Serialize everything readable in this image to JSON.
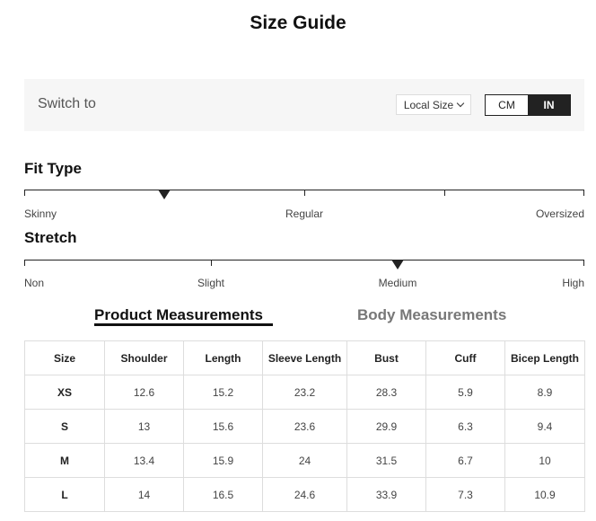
{
  "title": "Size Guide",
  "switch": {
    "label": "Switch to",
    "size_select": "Local Size",
    "units": [
      "CM",
      "IN"
    ],
    "active_unit": "IN"
  },
  "fit_type": {
    "title": "Fit Type",
    "labels": [
      "Skinny",
      "Regular",
      "Oversized"
    ],
    "level": 0.25
  },
  "stretch": {
    "title": "Stretch",
    "labels": [
      "Non",
      "Slight",
      "Medium",
      "High"
    ],
    "level": 0.667
  },
  "tabs": [
    {
      "label": "Product Measurements",
      "active": true
    },
    {
      "label": "Body Measurements",
      "active": false
    }
  ],
  "table": {
    "headers": [
      "Size",
      "Shoulder",
      "Length",
      "Sleeve Length",
      "Bust",
      "Cuff",
      "Bicep Length"
    ],
    "rows": [
      [
        "XS",
        "12.6",
        "15.2",
        "23.2",
        "28.3",
        "5.9",
        "8.9"
      ],
      [
        "S",
        "13",
        "15.6",
        "23.6",
        "29.9",
        "6.3",
        "9.4"
      ],
      [
        "M",
        "13.4",
        "15.9",
        "24",
        "31.5",
        "6.7",
        "10"
      ],
      [
        "L",
        "14",
        "16.5",
        "24.6",
        "33.9",
        "7.3",
        "10.9"
      ]
    ]
  }
}
